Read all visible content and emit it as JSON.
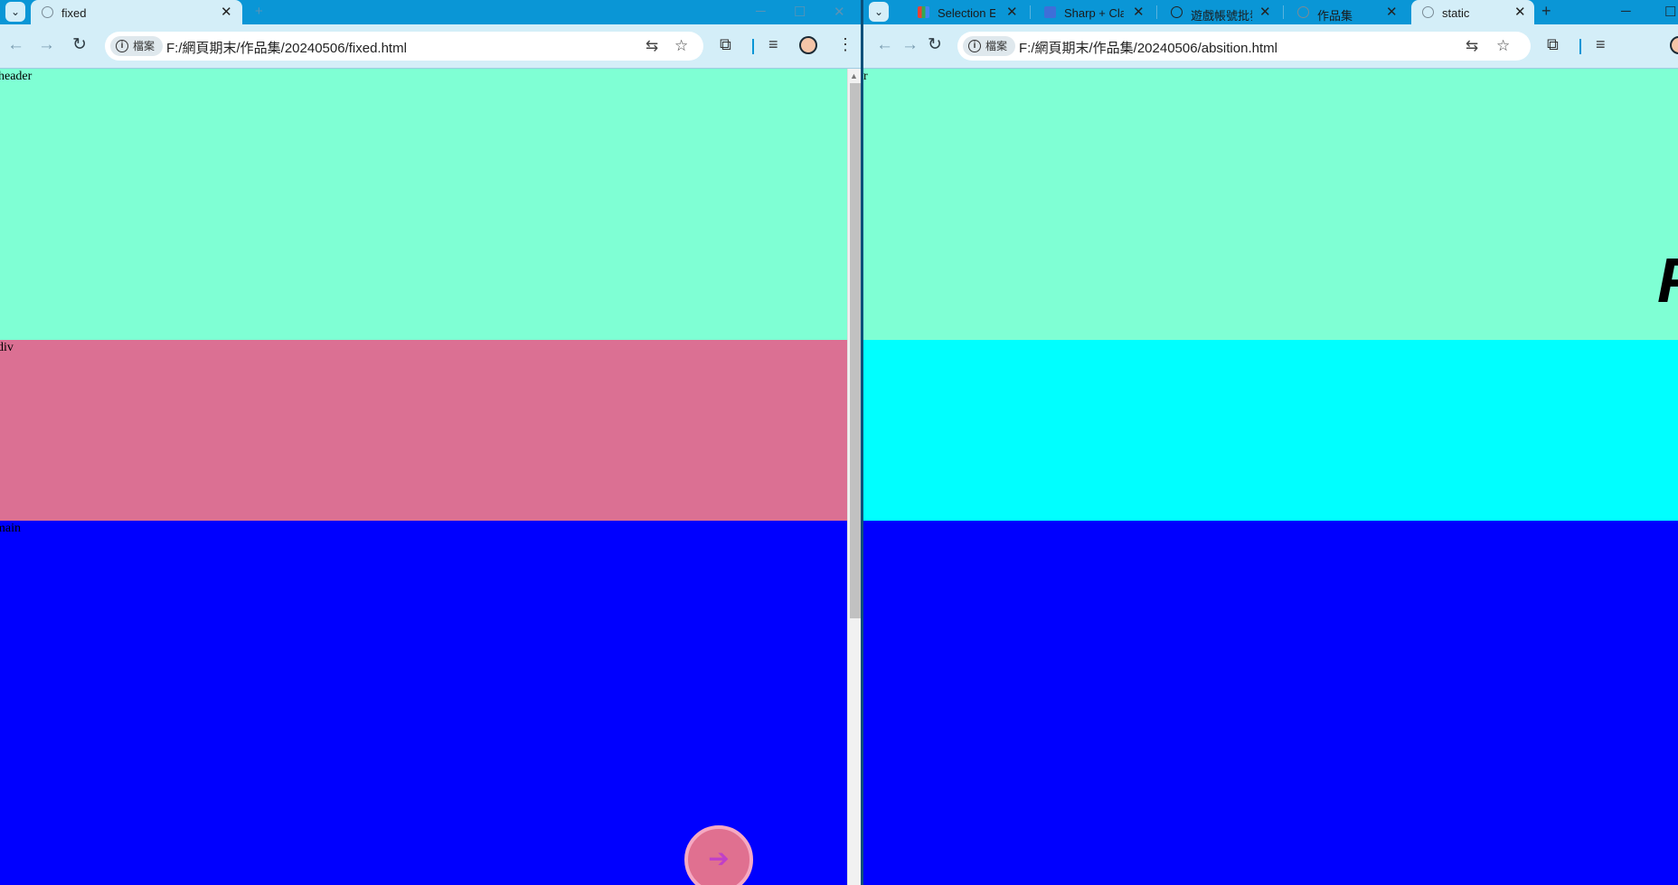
{
  "left_window": {
    "tab": {
      "title": "fixed"
    },
    "address": {
      "chip": "檔案",
      "url": "F:/網頁期末/作品集/20240506/fixed.html"
    },
    "sections": [
      {
        "label": "header",
        "color": "#7fffd4"
      },
      {
        "label": "div",
        "color": "#db7093"
      },
      {
        "label": "main",
        "color": "#0000ff"
      }
    ],
    "fab": {
      "icon": "arrow-right-icon",
      "glyph": "➔",
      "color": "#e07090"
    }
  },
  "right_window": {
    "tabs": [
      {
        "title": "Selection En"
      },
      {
        "title": "Sharp + Cla"
      },
      {
        "title": "遊戲帳號批發"
      },
      {
        "title": "作品集"
      },
      {
        "title": "static"
      }
    ],
    "address": {
      "chip": "檔案",
      "url": "F:/網頁期末/作品集/20240506/absition.html"
    },
    "header_label_fragment": "r",
    "sections": [
      {
        "color": "#7fffd4"
      },
      {
        "color": "#00ffff"
      },
      {
        "color": "#0000ff"
      }
    ],
    "big_text_fragment": "P"
  }
}
